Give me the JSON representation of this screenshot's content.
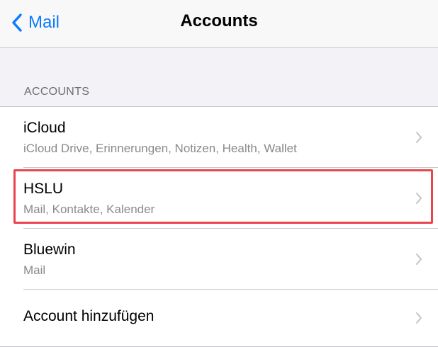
{
  "navbar": {
    "back_label": "Mail",
    "title": "Accounts"
  },
  "section": {
    "header": "ACCOUNTS"
  },
  "accounts": [
    {
      "title": "iCloud",
      "subtitle": "iCloud Drive, Erinnerungen, Notizen, Health, Wallet"
    },
    {
      "title": "HSLU",
      "subtitle": "Mail, Kontakte, Kalender"
    },
    {
      "title": "Bluewin",
      "subtitle": "Mail"
    }
  ],
  "add_account": {
    "label": "Account hinzufügen"
  },
  "colors": {
    "accent": "#0a7aff",
    "highlight": "#e8454f",
    "background": "#f2f2f7",
    "secondary_text": "#8a8a8e"
  },
  "icons": {
    "back": "chevron-left-icon",
    "disclosure": "chevron-right-icon"
  }
}
